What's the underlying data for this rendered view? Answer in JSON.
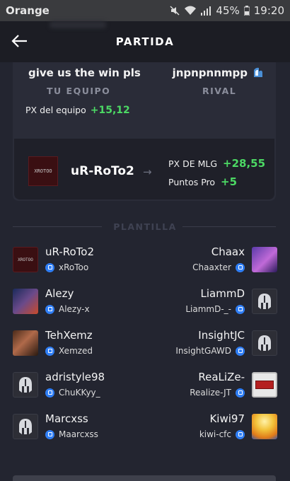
{
  "status_bar": {
    "carrier": "Orange",
    "battery": "45%",
    "time": "19:20"
  },
  "header": {
    "title": "PARTIDA"
  },
  "match": {
    "team_name": "give us the win pls",
    "rival_name": "jnpnpnnmpp",
    "team_label": "TU EQUIPO",
    "rival_label": "RIVAL",
    "team_px_label": "PX del equipo",
    "team_px_value": "+15,12",
    "player": {
      "avatar_text": "XROTOO",
      "name": "uR-RoTo2",
      "mlg_label": "PX DE MLG",
      "mlg_value": "+28,55",
      "pro_label": "Puntos Pro",
      "pro_value": "+5"
    }
  },
  "roster": {
    "label": "PLANTILLA",
    "rows": [
      {
        "left": {
          "name": "uR-RoTo2",
          "psn": "xRoToo"
        },
        "right": {
          "name": "Chaax",
          "psn": "Chaaxter"
        }
      },
      {
        "left": {
          "name": "Alezy",
          "psn": "Alezy-x"
        },
        "right": {
          "name": "LiammD",
          "psn": "LiammD-_-"
        }
      },
      {
        "left": {
          "name": "TehXemz",
          "psn": "Xemzed"
        },
        "right": {
          "name": "InsightJC",
          "psn": "InsightGAWD"
        }
      },
      {
        "left": {
          "name": "adristyle98",
          "psn": "ChuKKyy_"
        },
        "right": {
          "name": "ReaLiZe-",
          "psn": "Realize-JT"
        }
      },
      {
        "left": {
          "name": "Marcxss",
          "psn": "Maarcxss"
        },
        "right": {
          "name": "Kiwi97",
          "psn": "kiwi-cfc"
        }
      }
    ]
  },
  "colors": {
    "accent_green": "#4cd964",
    "psn_blue": "#2f7ef5",
    "background": "#232530"
  }
}
